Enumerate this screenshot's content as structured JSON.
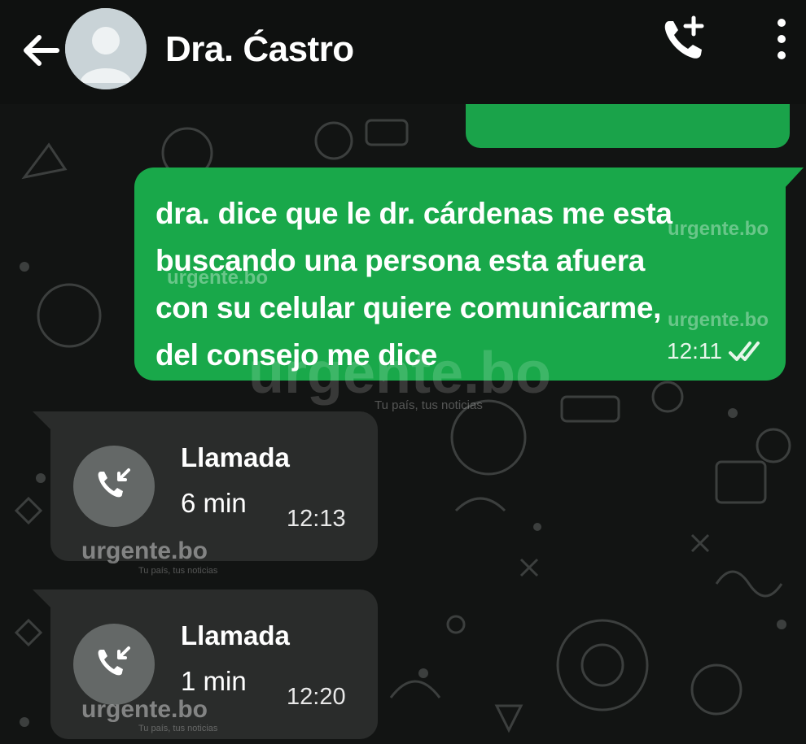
{
  "header": {
    "contact_name": "Dra. Ćastro",
    "back_icon": "arrow-left-icon",
    "avatar_icon": "default-avatar-icon",
    "call_icon": "add-call-icon",
    "menu_icon": "more-vertical-icon"
  },
  "messages": {
    "outgoing": {
      "lines": [
        "dra. dice que le dr. cárdenas me esta",
        "buscando una persona esta afuera",
        "con su celular quiere comunicarme,",
        "del consejo me dice"
      ],
      "time": "12:11",
      "status_icon": "double-check-icon"
    },
    "calls": [
      {
        "title": "Llamada",
        "duration": "6 min",
        "time": "12:13",
        "icon": "incoming-call-icon"
      },
      {
        "title": "Llamada",
        "duration": "1 min",
        "time": "12:20",
        "icon": "incoming-call-icon"
      }
    ]
  },
  "watermark": {
    "brand": "urgente.bo",
    "tagline": "Tu país, tus noticias"
  },
  "colors": {
    "outgoing_bubble": "#19a84a",
    "call_card": "#2a2c2b",
    "background": "#121413"
  }
}
